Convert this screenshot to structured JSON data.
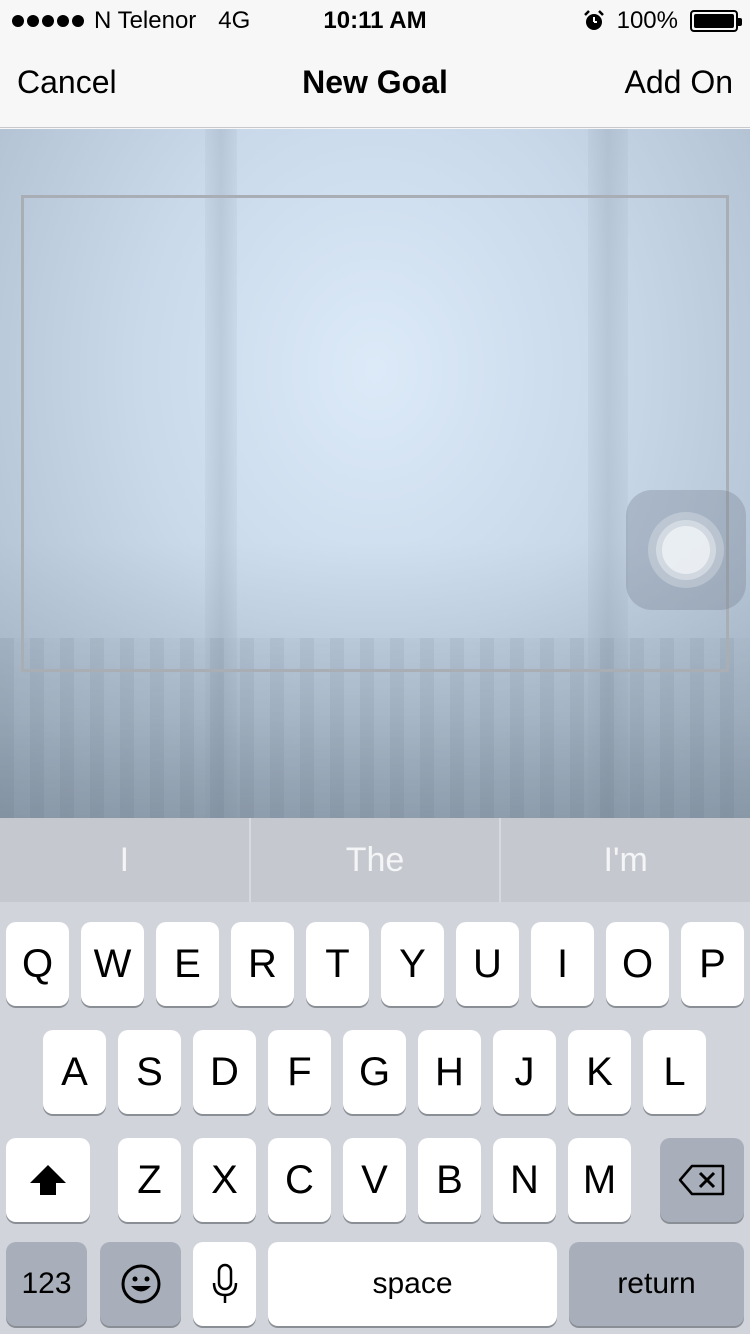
{
  "status_bar": {
    "carrier": "N Telenor",
    "network": "4G",
    "time": "10:11 AM",
    "battery_percent": "100%",
    "battery_level": 1.0,
    "icons": [
      "signal-dots-icon",
      "alarm-clock-icon",
      "battery-icon"
    ]
  },
  "nav": {
    "cancel_label": "Cancel",
    "title": "New Goal",
    "add_label": "Add On"
  },
  "suggestions": [
    "I",
    "The",
    "I'm"
  ],
  "keyboard": {
    "row1": [
      "Q",
      "W",
      "E",
      "R",
      "T",
      "Y",
      "U",
      "I",
      "O",
      "P"
    ],
    "row2": [
      "A",
      "S",
      "D",
      "F",
      "G",
      "H",
      "J",
      "K",
      "L"
    ],
    "row3": [
      "Z",
      "X",
      "C",
      "V",
      "B",
      "N",
      "M"
    ],
    "numbers_label": "123",
    "space_label": "space",
    "return_label": "return"
  },
  "colors": {
    "keyboard_bg": "#d1d5db",
    "key_dark": "#a8afba",
    "suggestion_bg": "#c5c9cf"
  }
}
